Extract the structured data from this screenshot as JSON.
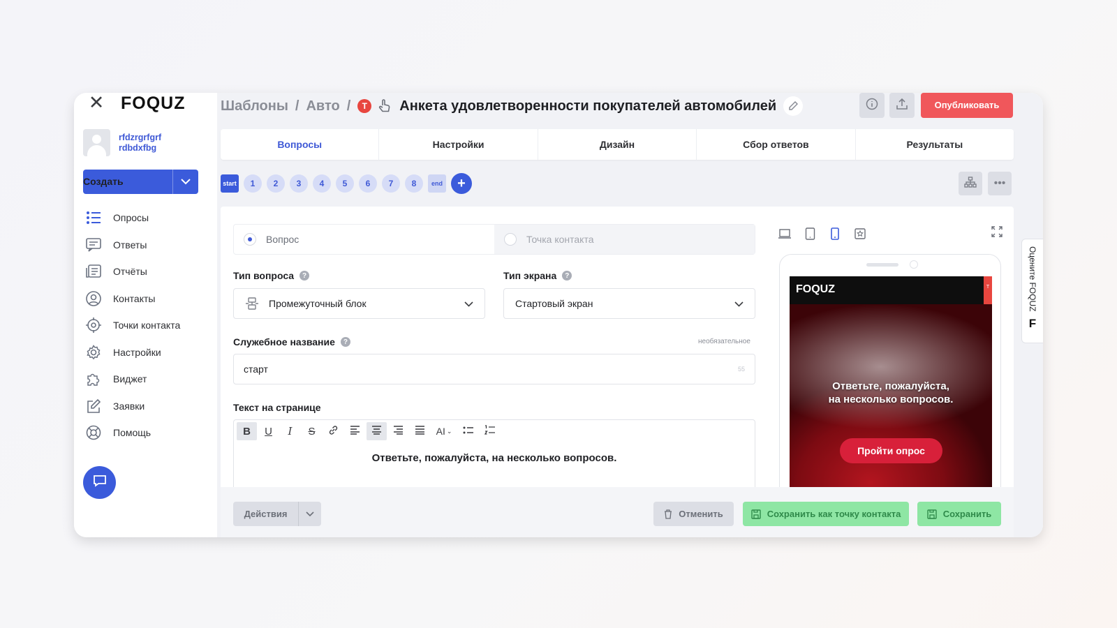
{
  "app": {
    "logo": "FOQUZ"
  },
  "user": {
    "line1": "rfdzrgrfgrf",
    "line2": "rdbdxfbg"
  },
  "sidebar": {
    "create_label": "Создать",
    "items": [
      {
        "label": "Опросы",
        "icon": "list-icon"
      },
      {
        "label": "Ответы",
        "icon": "chat-list-icon"
      },
      {
        "label": "Отчёты",
        "icon": "report-icon"
      },
      {
        "label": "Контакты",
        "icon": "user-circle-icon"
      },
      {
        "label": "Точки контакта",
        "icon": "target-icon"
      },
      {
        "label": "Настройки",
        "icon": "gear-icon"
      },
      {
        "label": "Виджет",
        "icon": "puzzle-icon"
      },
      {
        "label": "Заявки",
        "icon": "edit-icon"
      },
      {
        "label": "Помощь",
        "icon": "lifebuoy-icon"
      }
    ]
  },
  "header": {
    "crumb1": "Шаблоны",
    "crumb2": "Авто",
    "sep": "/",
    "badge": "T",
    "title": "Анкета удовлетворенности покупателей автомобилей",
    "publish_label": "Опубликовать"
  },
  "tabs": [
    "Вопросы",
    "Настройки",
    "Дизайн",
    "Сбор ответов",
    "Результаты"
  ],
  "steps": {
    "start": "start",
    "numbers": [
      "1",
      "2",
      "3",
      "4",
      "5",
      "6",
      "7",
      "8"
    ],
    "end": "end",
    "add": "+"
  },
  "form": {
    "segment_question": "Вопрос",
    "segment_contact": "Точка контакта",
    "question_type_label": "Тип вопроса",
    "question_type_value": "Промежуточный блок",
    "screen_type_label": "Тип экрана",
    "screen_type_value": "Стартовый экран",
    "service_name_label": "Служебное название",
    "optional": "необязательное",
    "service_name_value": "старт",
    "char_count": "55",
    "page_text_label": "Текст на странице",
    "page_text_value": "Ответьте, пожалуйста, на несколько вопросов.",
    "help": "?"
  },
  "toolbar": {
    "bold": "B",
    "underline": "U",
    "italic": "I",
    "strike": "S",
    "fontsize": "AI"
  },
  "preview": {
    "logo": "FOQUZ",
    "tag": "T",
    "text": "Ответьте, пожалуйста,\nна несколько вопросов.",
    "button": "Пройти опрос"
  },
  "rate": {
    "text": "Оцените FOQUZ",
    "letter": "F"
  },
  "footer": {
    "actions_label": "Действия",
    "cancel_label": "Отменить",
    "save_contact_label": "Сохранить как точку контакта",
    "save_label": "Сохранить"
  },
  "colors": {
    "accent": "#3b5bdb",
    "publish": "#f0575b",
    "save": "#8ee6a4"
  }
}
